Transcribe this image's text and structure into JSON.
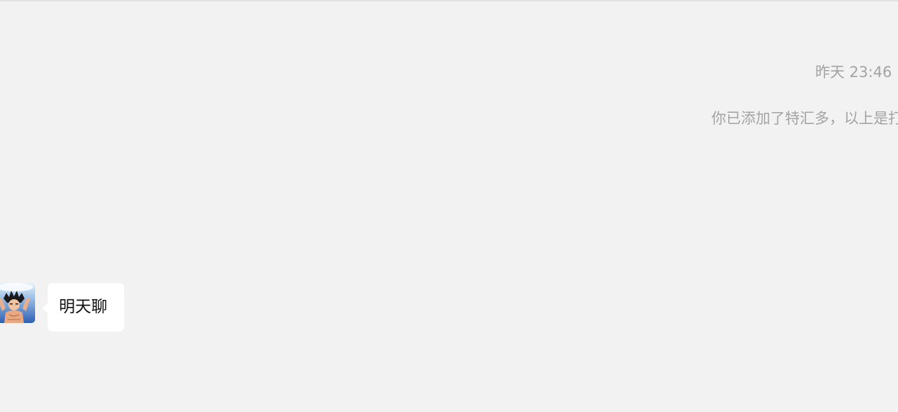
{
  "chat": {
    "timestamp": "昨天 23:46",
    "system_notice": "你已添加了特汇多，以上是打",
    "messages": [
      {
        "sender": "contact",
        "avatar_icon": "cartoon-character-avatar",
        "text": "明天聊"
      }
    ]
  },
  "colors": {
    "background": "#f2f2f2",
    "bubble": "#ffffff",
    "meta_text": "#a3a3a3",
    "message_text": "#111111"
  }
}
